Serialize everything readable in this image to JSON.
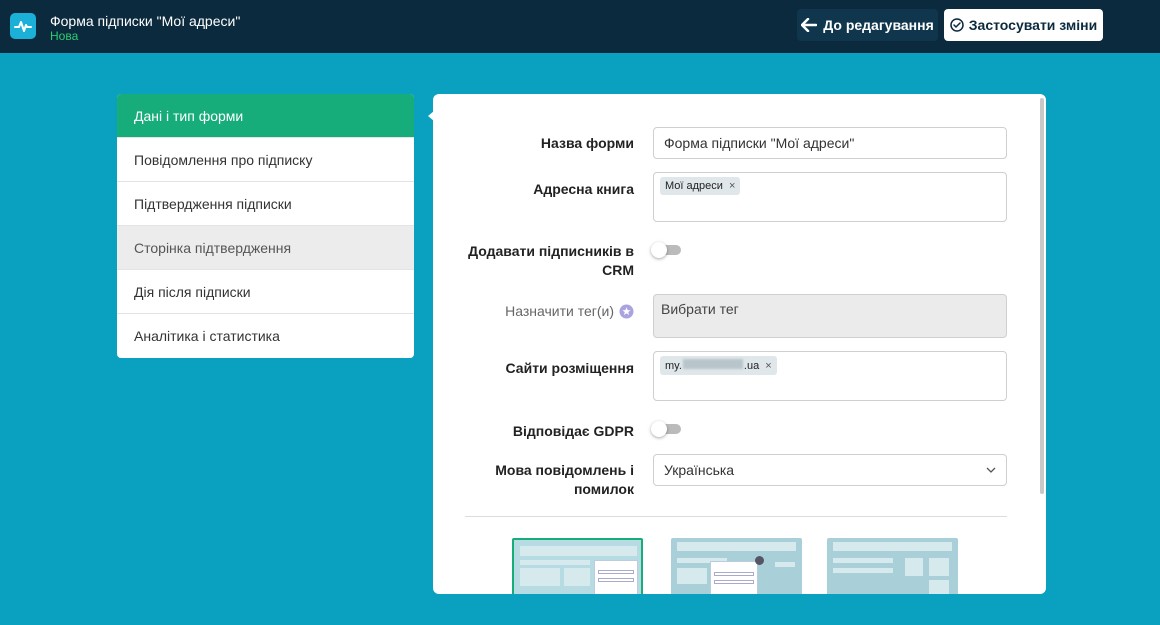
{
  "header": {
    "title": "Форма підписки \"Мої адреси\"",
    "status": "Нова",
    "back_label": "До редагування",
    "apply_label": "Застосувати зміни"
  },
  "menu": {
    "items": [
      {
        "label": "Дані і тип форми"
      },
      {
        "label": "Повідомлення про підписку"
      },
      {
        "label": "Підтвердження підписки"
      },
      {
        "label": "Сторінка підтвердження"
      },
      {
        "label": "Дія після підписки"
      },
      {
        "label": "Аналітика і статистика"
      }
    ]
  },
  "form": {
    "name_label": "Назва форми",
    "name_value": "Форма підписки \"Мої адреси\"",
    "book_label": "Адресна книга",
    "book_chip": "Мої адреси",
    "crm_label_1": "Додавати підписників в",
    "crm_label_2": "CRM",
    "crm_enabled": false,
    "tags_label": "Назначити тег(и)",
    "tags_placeholder": "Вибрати тег",
    "sites_label": "Сайти розміщення",
    "site_chip_prefix": "my.",
    "site_chip_suffix": ".ua",
    "gdpr_label": "Відповідає GDPR",
    "gdpr_enabled": false,
    "lang_label_1": "Мова повідомлень і",
    "lang_label_2": "помилок",
    "lang_value": "Українська",
    "chip_remove": "×"
  },
  "colors": {
    "background": "#0aa0c0",
    "topbar": "#0b2a3d",
    "accent": "#17ad7b"
  }
}
